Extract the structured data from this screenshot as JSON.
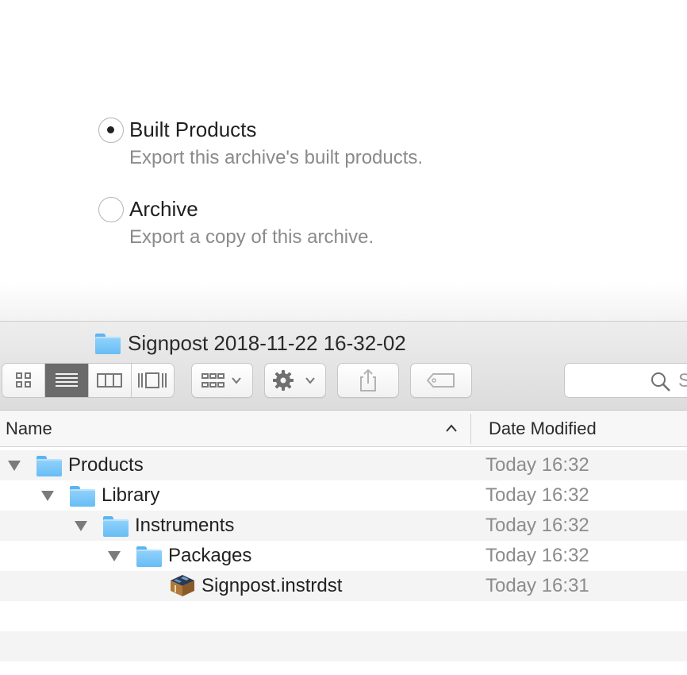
{
  "export_options": [
    {
      "title": "Built Products",
      "description": "Export this archive's built products.",
      "selected": true
    },
    {
      "title": "Archive",
      "description": "Export a copy of this archive.",
      "selected": false
    }
  ],
  "window": {
    "title": "Signpost 2018-11-22 16-32-02",
    "icon": "folder-icon"
  },
  "toolbar": {
    "view_modes": [
      "icon-view",
      "list-view",
      "column-view",
      "gallery-view"
    ],
    "active_view": "list-view",
    "search_placeholder": "S"
  },
  "columns": {
    "name": "Name",
    "date_modified": "Date Modified",
    "sort": "ascending"
  },
  "rows": [
    {
      "name": "Products",
      "date": "Today 16:32",
      "level": 0,
      "type": "folder",
      "expanded": true
    },
    {
      "name": "Library",
      "date": "Today 16:32",
      "level": 1,
      "type": "folder",
      "expanded": true
    },
    {
      "name": "Instruments",
      "date": "Today 16:32",
      "level": 2,
      "type": "folder",
      "expanded": true
    },
    {
      "name": "Packages",
      "date": "Today 16:32",
      "level": 3,
      "type": "folder",
      "expanded": true
    },
    {
      "name": "Signpost.instrdst",
      "date": "Today 16:31",
      "level": 4,
      "type": "package"
    }
  ],
  "colors": {
    "folder": "#67bdf5",
    "active_segment": "#6b6b6b",
    "secondary_text": "#8a8a8a"
  }
}
